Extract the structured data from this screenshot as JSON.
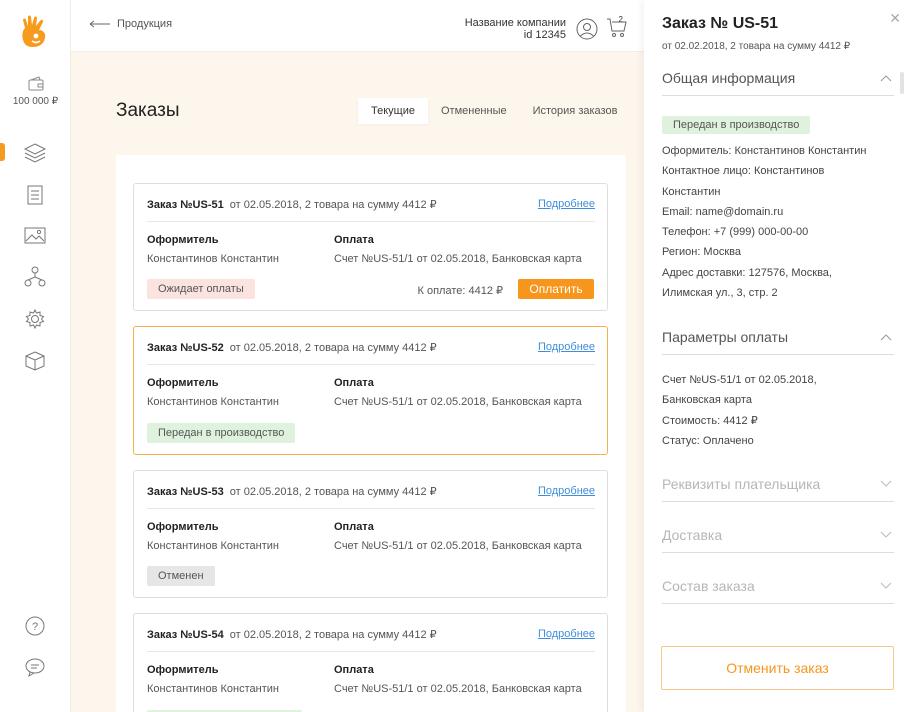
{
  "sidebar": {
    "balance": "100 000 ₽",
    "accent": "#f79b1e"
  },
  "topbar": {
    "back_label": "Продукция",
    "company_name": "Название компании",
    "company_id": "id 12345",
    "cart_count": "2"
  },
  "main": {
    "title": "Заказы",
    "tabs": [
      {
        "label": "Текущие",
        "active": true
      },
      {
        "label": "Отмененные",
        "active": false
      },
      {
        "label": "История заказов",
        "active": false
      }
    ],
    "orders": [
      {
        "number": "Заказ №US-51",
        "meta": "от 02.05.2018, 2 товара на сумму 4412 ₽",
        "more": "Подробнее",
        "author_label": "Оформитель",
        "author": "Константинов Константин",
        "payment_label": "Оплата",
        "payment": "Счет №US-51/1 от 02.05.2018, Банковская карта",
        "status": "Ожидает оплаты",
        "to_pay": "К оплате: 4412 ₽",
        "pay_button": "Оплатить"
      },
      {
        "number": "Заказ №US-52",
        "meta": "от 02.05.2018, 2 товара на сумму 4412 ₽",
        "more": "Подробнее",
        "author_label": "Оформитель",
        "author": "Константинов Константин",
        "payment_label": "Оплата",
        "payment": "Счет №US-51/1 от 02.05.2018, Банковская карта",
        "status": "Передан в производство"
      },
      {
        "number": "Заказ №US-53",
        "meta": "от 02.05.2018, 2 товара на сумму 4412 ₽",
        "more": "Подробнее",
        "author_label": "Оформитель",
        "author": "Константинов Константин",
        "payment_label": "Оплата",
        "payment": "Счет №US-51/1 от 02.05.2018, Банковская карта",
        "status": "Отменен"
      },
      {
        "number": "Заказ №US-54",
        "meta": "от 02.05.2018, 2 товара на сумму 4412 ₽",
        "more": "Подробнее",
        "author_label": "Оформитель",
        "author": "Константинов Константин",
        "payment_label": "Оплата",
        "payment": "Счет №US-51/1 от 02.05.2018, Банковская карта"
      }
    ]
  },
  "panel": {
    "title": "Заказ № US-51",
    "subtitle": "от 02.02.2018, 2 товара на сумму 4412 ₽",
    "sections": {
      "general": "Общая информация",
      "payment_params": "Параметры оплаты",
      "payer": "Реквизиты плательщика",
      "delivery": "Доставка",
      "contents": "Состав заказа"
    },
    "status_badge": "Передан в производство",
    "general_lines": [
      "Оформитель: Константинов Константин",
      "Контактное лицо: Константинов",
      "Константин",
      "Email: name@domain.ru",
      "Телефон: +7 (999) 000-00-00",
      "Регион: Москва",
      "Адрес доставки: 127576, Москва,",
      "Илимская ул., 3, стр. 2"
    ],
    "payment_lines": [
      "Счет №US-51/1 от 02.05.2018,",
      "Банковская карта",
      "Стоимость: 4412 ₽",
      "Статус: Оплачено"
    ],
    "cancel_button": "Отменить заказ"
  }
}
